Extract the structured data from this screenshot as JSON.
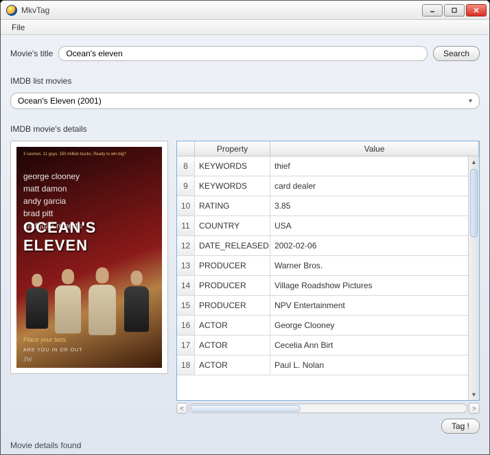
{
  "window": {
    "title": "MkvTag"
  },
  "menu": {
    "file": "File"
  },
  "search": {
    "label": "Movie's title",
    "value": "Ocean's eleven",
    "button": "Search"
  },
  "imdb_list": {
    "label": "IMDB list movies",
    "selected": "Ocean's Eleven  (2001)"
  },
  "details": {
    "label": "IMDB movie's details"
  },
  "poster": {
    "credits": [
      "george clooney",
      "matt damon",
      "andy garcia",
      "brad pitt",
      "and julia roberts"
    ],
    "title": "OCEAN'S ELEVEN",
    "tagline": "Place your bets.",
    "studio": "JW"
  },
  "table": {
    "headers": {
      "property": "Property",
      "value": "Value"
    },
    "start_index": 8,
    "rows": [
      {
        "n": 8,
        "property": "KEYWORDS",
        "value": "thief"
      },
      {
        "n": 9,
        "property": "KEYWORDS",
        "value": "card dealer"
      },
      {
        "n": 10,
        "property": "RATING",
        "value": "3.85"
      },
      {
        "n": 11,
        "property": "COUNTRY",
        "value": "USA"
      },
      {
        "n": 12,
        "property": "DATE_RELEASED",
        "value": "2002-02-06"
      },
      {
        "n": 13,
        "property": "PRODUCER",
        "value": "Warner Bros."
      },
      {
        "n": 14,
        "property": "PRODUCER",
        "value": "Village Roadshow Pictures"
      },
      {
        "n": 15,
        "property": "PRODUCER",
        "value": "NPV Entertainment"
      },
      {
        "n": 16,
        "property": "ACTOR",
        "value": "George Clooney"
      },
      {
        "n": 17,
        "property": "ACTOR",
        "value": "Cecelia Ann Birt"
      },
      {
        "n": 18,
        "property": "ACTOR",
        "value": "Paul L. Nolan"
      }
    ]
  },
  "tag_button": "Tag !",
  "status": "Movie details found"
}
